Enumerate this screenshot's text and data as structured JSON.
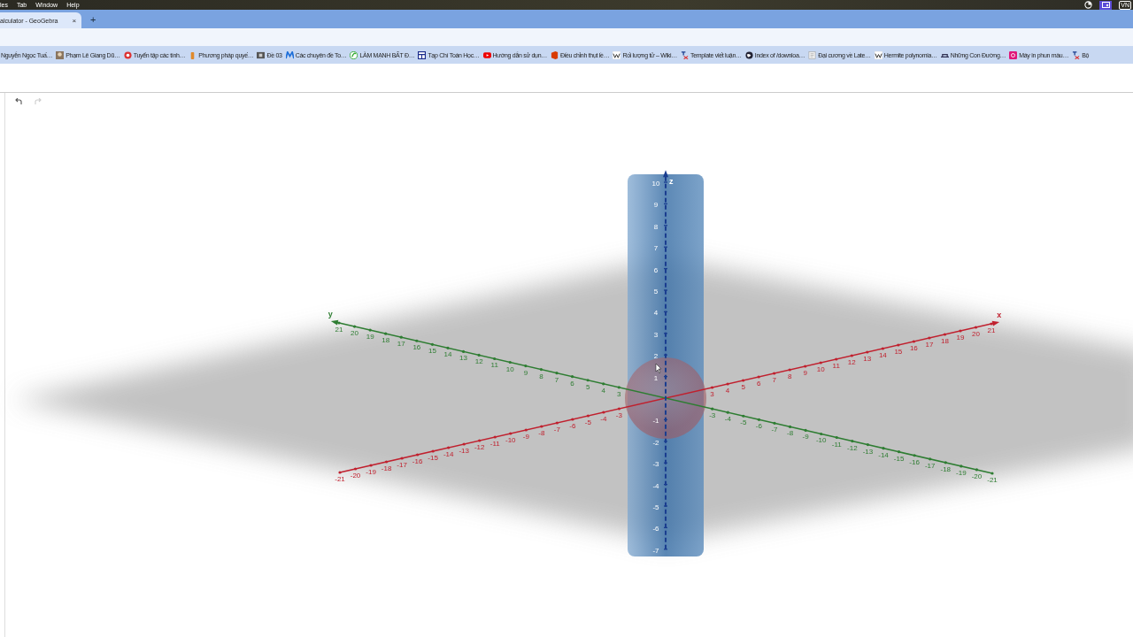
{
  "menu_bar": {
    "items": [
      "les",
      "Tab",
      "Window",
      "Help"
    ],
    "input_source": "VN"
  },
  "tabs": [
    {
      "title": "alculator - GeoGebra",
      "selected": true,
      "close": "×"
    }
  ],
  "new_tab": "+",
  "bookmarks": [
    {
      "label": "Nguyễn Ngọc Tuấ…",
      "kind": "none"
    },
    {
      "label": "Phạm Lê Giang Dũ…",
      "kind": "avatar"
    },
    {
      "label": "Tuyển tập các tính…",
      "kind": "circle"
    },
    {
      "label": "Phương pháp quyế…",
      "kind": "bottle"
    },
    {
      "label": "Đề 03",
      "kind": "film"
    },
    {
      "label": "Các chuyên đề To…",
      "kind": "letter"
    },
    {
      "label": "LÀM MẠNH BẤT Đ…",
      "kind": "leaf"
    },
    {
      "label": "Tạp Chí Toán Học…",
      "kind": "grid"
    },
    {
      "label": "Hướng dẫn sử dụn…",
      "kind": "video"
    },
    {
      "label": "Điều chỉnh thụt lề…",
      "kind": "office"
    },
    {
      "label": "Rối lượng tử – Wiki…",
      "kind": "wiki"
    },
    {
      "label": "Template viết luận…",
      "kind": "tex"
    },
    {
      "label": "Index of /downloa…",
      "kind": "globe"
    },
    {
      "label": "Đại cương về Late…",
      "kind": "page"
    },
    {
      "label": "Hermite polynomia…",
      "kind": "wiki"
    },
    {
      "label": "Những Con Đường…",
      "kind": "road"
    },
    {
      "label": "Máy in phun màu…",
      "kind": "square"
    },
    {
      "label": "Bộ",
      "kind": "tex"
    }
  ],
  "toolbar": {
    "undo_enabled": true,
    "redo_enabled": false
  },
  "graphics_3d": {
    "axes": [
      {
        "kind": "x",
        "name": "x",
        "color": "#c0202e",
        "ticks": [
          "-21",
          "-20",
          "-19",
          "-18",
          "-17",
          "-16",
          "-15",
          "-14",
          "-13",
          "-12",
          "-11",
          "-10",
          "-9",
          "-8",
          "-7",
          "-6",
          "-5",
          "-4",
          "-3",
          "3",
          "4",
          "5",
          "6",
          "7",
          "8",
          "9",
          "10",
          "11",
          "12",
          "13",
          "14",
          "15",
          "16",
          "17",
          "18",
          "19",
          "20",
          "21"
        ]
      },
      {
        "kind": "y",
        "name": "y",
        "color": "#2e7d32",
        "ticks": [
          "21",
          "20",
          "19",
          "18",
          "17",
          "16",
          "15",
          "14",
          "13",
          "12",
          "11",
          "10",
          "9",
          "8",
          "7",
          "6",
          "5",
          "4",
          "3",
          "-3",
          "-4",
          "-5",
          "-6",
          "-7",
          "-8",
          "-9",
          "-10",
          "-11",
          "-12",
          "-13",
          "-14",
          "-15",
          "-16",
          "-17",
          "-18",
          "-19",
          "-20",
          "-21"
        ]
      },
      {
        "kind": "z",
        "name": "z",
        "color": "#1a3d8f",
        "ticks": [
          "10",
          "9",
          "8",
          "7",
          "6",
          "5",
          "4",
          "3",
          "2",
          "1",
          "-1",
          "-2",
          "-3",
          "-4",
          "-5",
          "-6",
          "-7"
        ]
      }
    ]
  }
}
